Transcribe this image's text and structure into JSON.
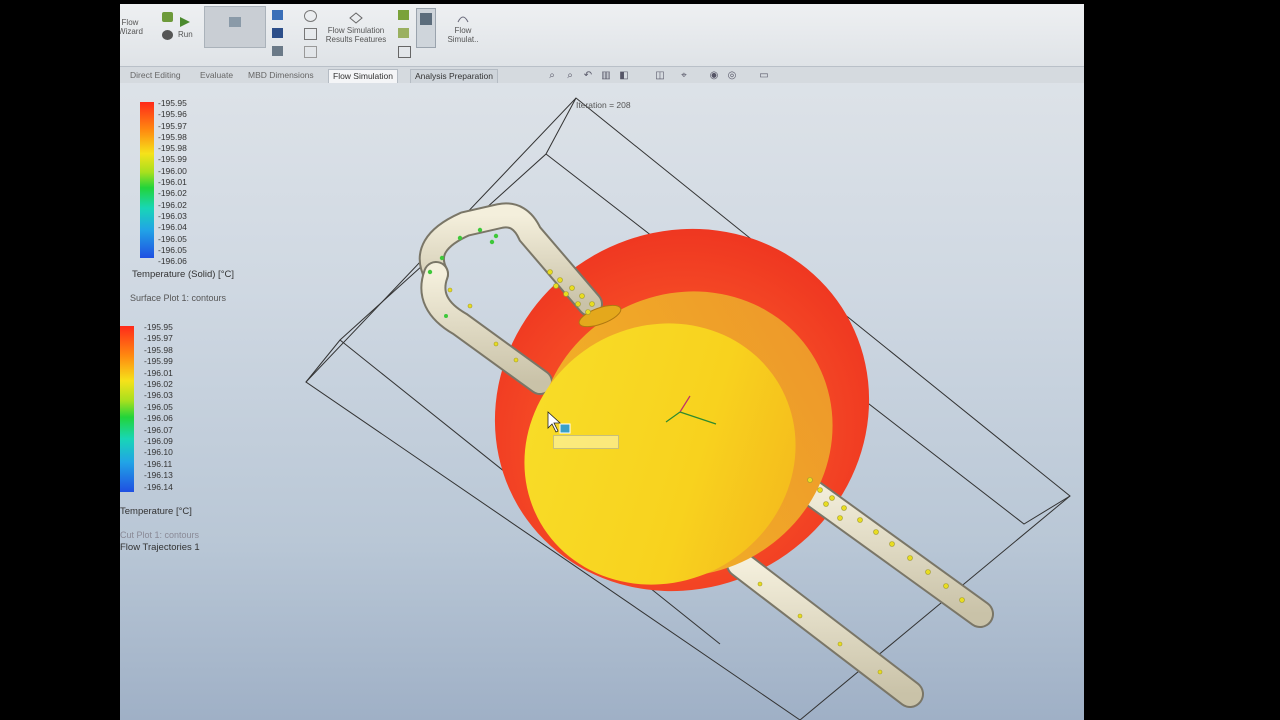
{
  "ribbon": {
    "run_label": "Run",
    "results_features_label": "Flow Simulation Results Features",
    "flow_simulation_label": "Flow Simulat..",
    "left_partial_label": "Flow Wizard"
  },
  "tabs": [
    {
      "label": "Direct Editing",
      "active": false
    },
    {
      "label": "Evaluate",
      "active": false
    },
    {
      "label": "MBD Dimensions",
      "active": false
    },
    {
      "label": "Flow Simulation",
      "active": true
    },
    {
      "label": "Analysis Preparation",
      "active": false
    }
  ],
  "viewport": {
    "iteration_text": "Iteration = 208"
  },
  "legend_solid": {
    "ticks": [
      "-195.95",
      "-195.96",
      "-195.97",
      "-195.98",
      "-195.98",
      "-195.99",
      "-196.00",
      "-196.01",
      "-196.02",
      "-196.02",
      "-196.03",
      "-196.04",
      "-196.05",
      "-196.05",
      "-196.06"
    ],
    "title": "Temperature (Solid) [°C]",
    "plot_name": "Surface Plot 1: contours"
  },
  "legend_fluid": {
    "ticks": [
      "-195.95",
      "-195.97",
      "-195.98",
      "-195.99",
      "-196.01",
      "-196.02",
      "-196.03",
      "-196.05",
      "-196.06",
      "-196.07",
      "-196.09",
      "-196.10",
      "-196.11",
      "-196.13",
      "-196.14"
    ],
    "title": "Temperature [°C]",
    "plot_name": "Cut Plot 1: contours",
    "trajectory_name": "Flow Trajectories 1"
  },
  "colors": {
    "hot": "#f43a22",
    "warm": "#f6c21a",
    "pipe": "#ece6cf",
    "particle": "#e8dc20"
  }
}
